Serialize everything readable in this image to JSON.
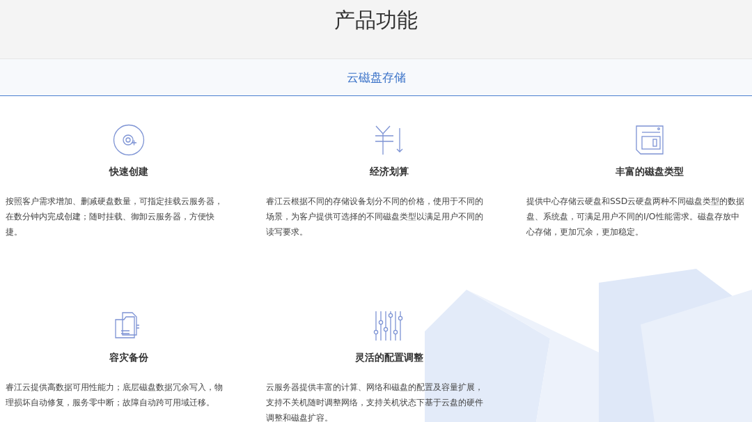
{
  "page_title": "产品功能",
  "tabs": [
    {
      "label": "云磁盘存储",
      "selected": true
    }
  ],
  "features": [
    {
      "title": "快速创建",
      "description": "按照客户需求增加、删减硬盘数量，可指定挂载云服务器，在数分钟内完成创建；随时挂载、御卸云服务器，方便快捷。"
    },
    {
      "title": "经济划算",
      "description": "睿江云根据不同的存储设备划分不同的价格，使用于不同的场景，为客户提供可选择的不同磁盘类型以满足用户不同的读写要求。"
    },
    {
      "title": "丰富的磁盘类型",
      "description": "提供中心存储云硬盘和SSD云硬盘两种不同磁盘类型的数据盘、系统盘，可满足用户不同的I/O性能需求。磁盘存放中心存储，更加冗余，更加稳定。"
    },
    {
      "title": "容灾备份",
      "description": "睿江云提供高数据可用性能力；底层磁盘数据冗余写入，物理损坏自动修复，服务零中断；故障自动跨可用域迁移。"
    },
    {
      "title": "灵活的配置调整",
      "description": "云服务器提供丰富的计算、网络和磁盘的配置及容量扩展，支持不关机随时调整网络，支持关机状态下基于云盘的硬件调整和磁盘扩容。"
    }
  ]
}
